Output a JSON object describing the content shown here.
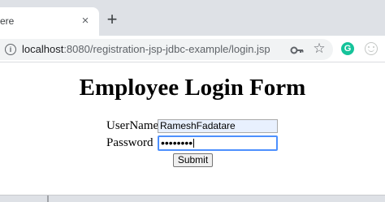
{
  "browser": {
    "tab": {
      "title": "ere",
      "close_label": "×"
    },
    "new_tab_label": "+",
    "address_bar": {
      "host": "localhost",
      "path": ":8080/registration-jsp-jdbc-example/login.jsp"
    },
    "icons": [
      "info-icon",
      "key-icon",
      "star-icon",
      "grammarly-icon",
      "profile-icon"
    ],
    "grammarly_glyph": "G",
    "accent_color": "#15c39a"
  },
  "page": {
    "title": "Employee Login Form",
    "form": {
      "username_label": "UserName",
      "username_value": "RameshFadatare",
      "password_label": "Password",
      "password_masked": "••••••••",
      "submit_label": "Submit"
    }
  }
}
